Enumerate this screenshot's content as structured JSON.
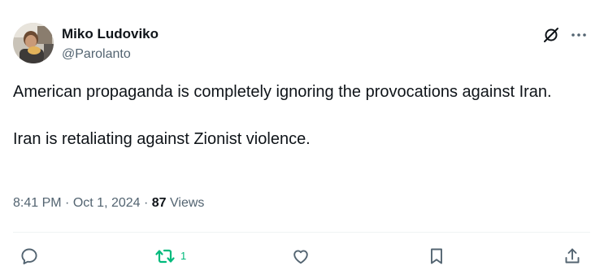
{
  "author": {
    "display_name": "Miko Ludoviko",
    "handle": "@Parolanto"
  },
  "tweet": {
    "paragraphs": [
      "American propaganda is completely ignoring the provocations against Iran.",
      "Iran is retaliating against Zionist violence."
    ]
  },
  "meta": {
    "time": "8:41 PM",
    "sep1": "·",
    "date": "Oct 1, 2024",
    "sep2": "·",
    "views_count": "87",
    "views_label": "Views"
  },
  "actions": {
    "repost_count": "1"
  },
  "icons": {
    "grok": "grok-icon",
    "more": "more-icon",
    "reply": "reply-icon",
    "repost": "repost-icon",
    "like": "heart-icon",
    "bookmark": "bookmark-icon",
    "share": "share-icon"
  },
  "colors": {
    "text": "#0f1419",
    "secondary": "#536471",
    "repost_active": "#00ba7c",
    "divider": "#eff3f4"
  }
}
